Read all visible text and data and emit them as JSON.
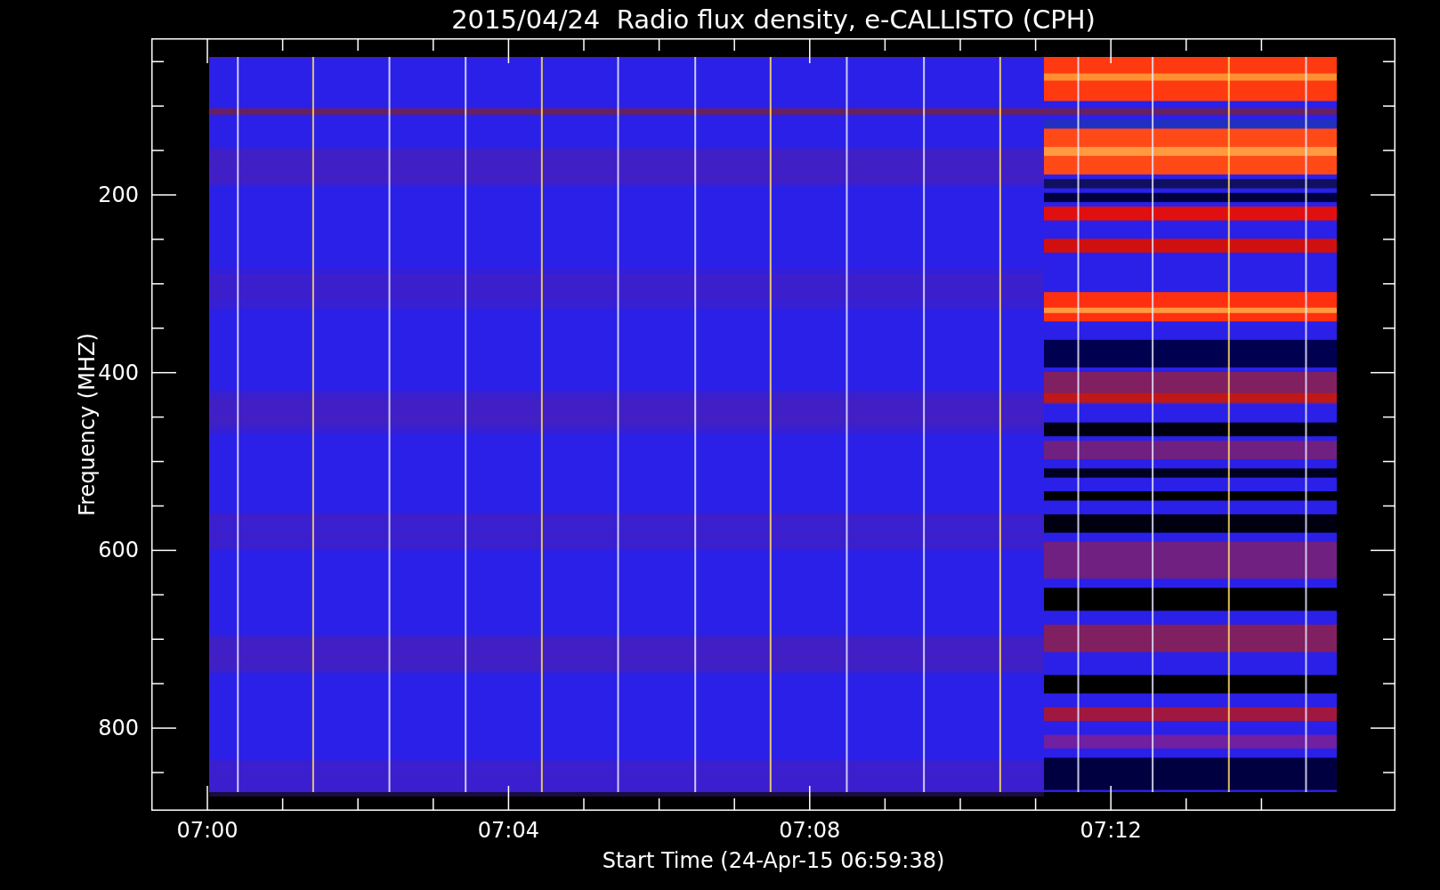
{
  "title": "2015/04/24  Radio flux density, e-CALLISTO (CPH)",
  "y_axis": {
    "label": "Frequency (MHZ)",
    "ticks": [
      "200",
      "400",
      "600",
      "800"
    ]
  },
  "x_axis": {
    "label": "Start Time (24-Apr-15 06:59:38)",
    "ticks": [
      "07:00",
      "07:04",
      "07:08",
      "07:12"
    ]
  }
}
